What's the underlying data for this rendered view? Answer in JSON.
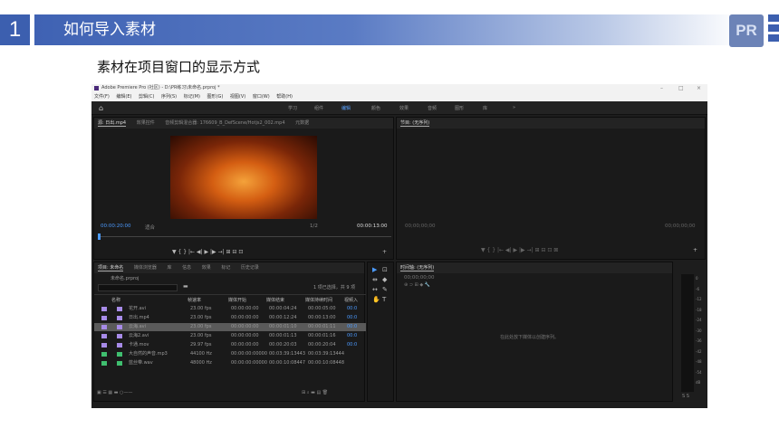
{
  "slide": {
    "number": "1",
    "title": "如何导入素材",
    "logo_text": "PR",
    "subtitle": "素材在项目窗口的显示方式"
  },
  "app": {
    "window_title": "Adobe Premiere Pro (社区) - D:\\PR练习\\未命名.prproj *",
    "window_controls": [
      "–",
      "□",
      "×"
    ],
    "menu": [
      "文件(F)",
      "编辑(E)",
      "剪辑(C)",
      "序列(S)",
      "标记(M)",
      "图形(G)",
      "视图(V)",
      "窗口(W)",
      "帮助(H)"
    ],
    "workspaces": [
      "学习",
      "组件",
      "编辑",
      "颜色",
      "效果",
      "音频",
      "图形",
      "库",
      "»"
    ],
    "active_workspace": "编辑",
    "source_panel": {
      "tabs": [
        "源: 日出.mp4",
        "效果控件",
        "音频剪辑混合器: 176609_B_DefScene/Hotjs2_002.mp4",
        "元数据"
      ],
      "timecode_in": "00:00:20:00",
      "fit": "适合",
      "ratio": "1/2",
      "timecode_out": "00:00:13:00"
    },
    "program_panel": {
      "tab": "节目: (无序列)",
      "timecode_left": "00;00;00;00",
      "timecode_right": "00;00;00;00"
    },
    "project_panel": {
      "tabs": [
        "项目: 未命名",
        "媒体浏览器",
        "库",
        "信息",
        "效果",
        "标记",
        "历史记录"
      ],
      "project_file": "未命名.prproj",
      "item_count": "1 项已选择，共 9 项",
      "columns": [
        "名称",
        "帧速率",
        "媒体开始",
        "媒体结束",
        "媒体持续时间",
        "视频入"
      ],
      "items": [
        {
          "name": "花开.avi",
          "fps": "23.00 fps",
          "start": "00:00:00:00",
          "end": "00:00:04:24",
          "dur": "00:00:05:00",
          "in": "00:0",
          "color": "#a78be8"
        },
        {
          "name": "日出.mp4",
          "fps": "23.00 fps",
          "start": "00:00:00:00",
          "end": "00:00:12:24",
          "dur": "00:00:13:00",
          "in": "00:0",
          "color": "#a78be8"
        },
        {
          "name": "云海.avi",
          "fps": "23.00 fps",
          "start": "00:00:00:00",
          "end": "00:00:01:10",
          "dur": "00:00:01:11",
          "in": "00:0",
          "color": "#a78be8"
        },
        {
          "name": "云海2.avi",
          "fps": "23.00 fps",
          "start": "00:00:00:00",
          "end": "00:00:01:13",
          "dur": "00:00:01:16",
          "in": "00:0",
          "color": "#a78be8"
        },
        {
          "name": "卡通.mov",
          "fps": "29.97 fps",
          "start": "00:00:00:00",
          "end": "00:00:20:03",
          "dur": "00:00:20:04",
          "in": "00:0",
          "color": "#a78be8"
        },
        {
          "name": "大自然的声音.mp3",
          "fps": "44100 Hz",
          "start": "00:00:00:00000",
          "end": "00:03:39:13443",
          "dur": "00:03:39:13444",
          "in": "",
          "color": "#3fbf6f"
        },
        {
          "name": "蓝丝带.wav",
          "fps": "48000 Hz",
          "start": "00:00:00:00000",
          "end": "00:00:10:08447",
          "dur": "00:00:10:08448",
          "in": "",
          "color": "#3fbf6f"
        }
      ],
      "selected_index": 2
    },
    "timeline_panel": {
      "tab": "时间轴: (无序列)",
      "timecode": "00;00;00;00",
      "drop_hint": "在此处放下媒体以创建序列。"
    },
    "meter_labels": [
      "0",
      "-6",
      "-12",
      "-18",
      "-24",
      "-30",
      "-36",
      "-42",
      "-48",
      "-54",
      "dB"
    ],
    "colors": {
      "accent": "#4c9bff",
      "slide_blue": "#3c5faf"
    }
  }
}
